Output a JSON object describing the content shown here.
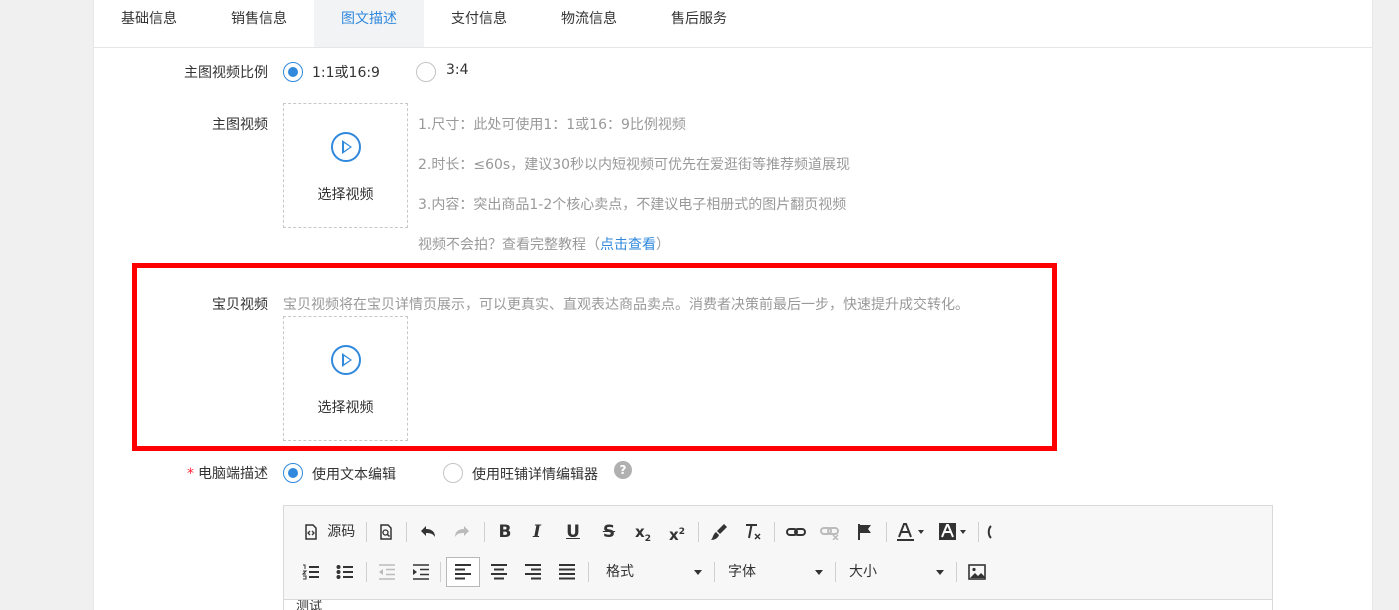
{
  "tabs": [
    {
      "label": "基础信息",
      "active": false
    },
    {
      "label": "销售信息",
      "active": false
    },
    {
      "label": "图文描述",
      "active": true
    },
    {
      "label": "支付信息",
      "active": false
    },
    {
      "label": "物流信息",
      "active": false
    },
    {
      "label": "售后服务",
      "active": false
    }
  ],
  "ratio": {
    "label": "主图视频比例",
    "options": [
      {
        "label": "1:1或16:9",
        "checked": true
      },
      {
        "label": "3:4",
        "checked": false
      }
    ]
  },
  "main_video": {
    "label": "主图视频",
    "upload_label": "选择视频",
    "tips": [
      "1.尺寸：此处可使用1：1或16：9比例视频",
      "2.时长：≤60s，建议30秒以内短视频可优先在爱逛街等推荐频道展现",
      "3.内容：突出商品1-2个核心卖点，不建议电子相册式的图片翻页视频"
    ],
    "tutorial_prefix": "视频不会拍？查看完整教程（",
    "tutorial_link": "点击查看",
    "tutorial_suffix": "）"
  },
  "item_video": {
    "label": "宝贝视频",
    "tip": "宝贝视频将在宝贝详情页展示，可以更真实、直观表达商品卖点。消费者决策前最后一步，快速提升成交转化。",
    "upload_label": "选择视频"
  },
  "pc_desc": {
    "required_mark": "*",
    "label": "电脑端描述",
    "options": [
      {
        "label": "使用文本编辑",
        "checked": true
      },
      {
        "label": "使用旺铺详情编辑器",
        "checked": false
      }
    ],
    "help": "?"
  },
  "editor": {
    "source_label": "源码",
    "format_label": "格式",
    "font_label": "字体",
    "size_label": "大小",
    "content": "测试"
  },
  "colors": {
    "accent": "#3089dc",
    "highlight": "#ff0000"
  }
}
